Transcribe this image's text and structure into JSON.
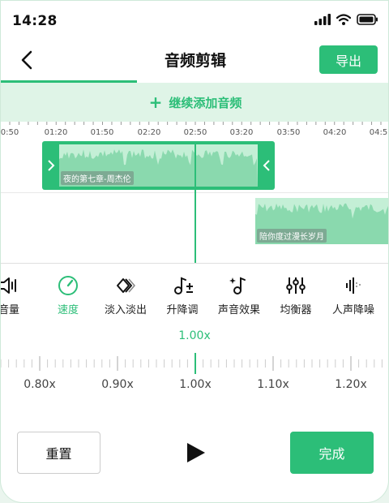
{
  "status_bar": {
    "time": "14:28"
  },
  "header": {
    "title": "音频剪辑",
    "export_label": "导出"
  },
  "add_audio": {
    "plus": "+",
    "label": "继续添加音频"
  },
  "timeline": {
    "ticks": [
      "0:50",
      "01:20",
      "01:50",
      "02:20",
      "02:50",
      "03:20",
      "03:50",
      "04:20",
      "04:5"
    ],
    "tracks": [
      {
        "name": "夜的第七章-周杰伦",
        "selected": true
      },
      {
        "name": "陪你度过漫长岁月",
        "selected": false
      }
    ]
  },
  "tools": [
    {
      "label": "音量",
      "icon": "volume-icon"
    },
    {
      "label": "速度",
      "icon": "speed-gauge-icon",
      "active": true
    },
    {
      "label": "淡入淡出",
      "icon": "fade-icon"
    },
    {
      "label": "升降调",
      "icon": "pitch-icon"
    },
    {
      "label": "声音效果",
      "icon": "sound-effect-icon"
    },
    {
      "label": "均衡器",
      "icon": "equalizer-icon"
    },
    {
      "label": "人声降噪",
      "icon": "noise-reduction-icon"
    }
  ],
  "speed": {
    "current": "1.00x",
    "labels": [
      "0.80x",
      "0.90x",
      "1.00x",
      "1.10x",
      "1.20x"
    ]
  },
  "actions": {
    "reset_label": "重置",
    "done_label": "完成"
  },
  "colors": {
    "accent": "#2cbe78",
    "accent_light": "#c4efd6",
    "add_bar_bg": "#dff4e7"
  }
}
